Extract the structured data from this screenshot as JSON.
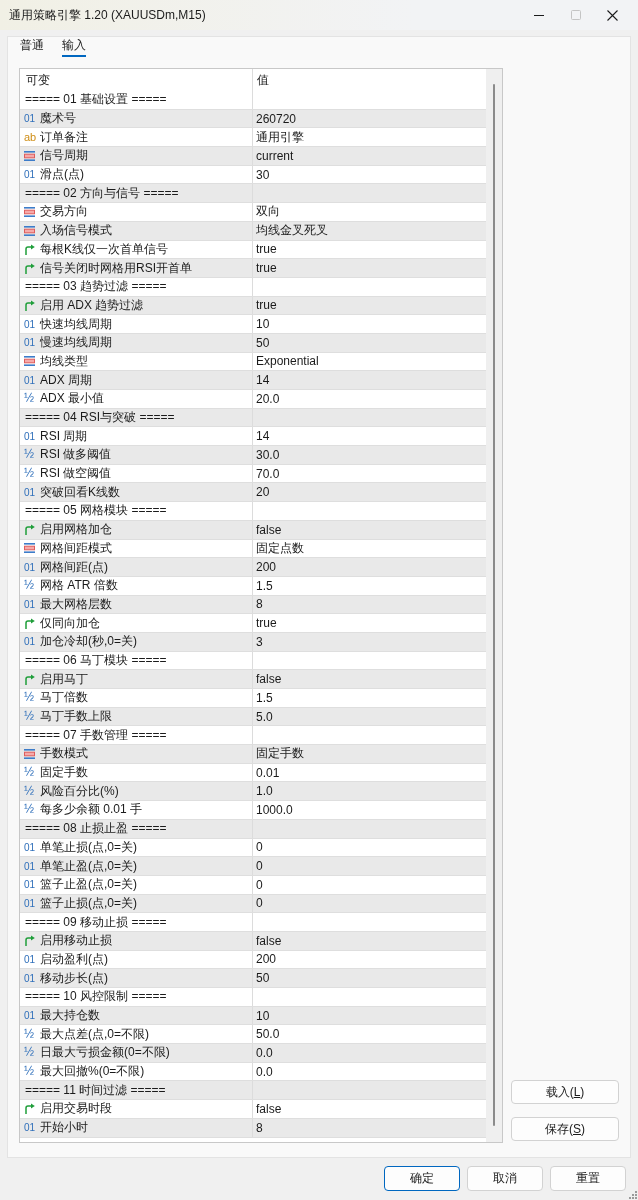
{
  "window": {
    "title": "通用策略引擎 1.20 (XAUUSDm,M15)",
    "controls": [
      {
        "kind": "minimize",
        "disabled": false
      },
      {
        "kind": "maximize",
        "disabled": true
      },
      {
        "kind": "close",
        "disabled": false
      }
    ]
  },
  "tabs": [
    {
      "label": "普通",
      "selected": false
    },
    {
      "label": "输入",
      "selected": true
    }
  ],
  "table": {
    "columns": [
      "可变",
      "值"
    ],
    "rows": [
      {
        "kind": "section",
        "label": "===== 01 基础设置 ====="
      },
      {
        "kind": "int",
        "glyph": "01",
        "name": "魔术号",
        "value": "260720"
      },
      {
        "kind": "string",
        "glyph": "ab",
        "name": "订单备注",
        "value": "通用引擎"
      },
      {
        "kind": "enum",
        "name": "信号周期",
        "value": "current"
      },
      {
        "kind": "int",
        "glyph": "01",
        "name": "滑点(点)",
        "value": "30"
      },
      {
        "kind": "section",
        "label": "===== 02 方向与信号 ====="
      },
      {
        "kind": "enum",
        "name": "交易方向",
        "value": "双向"
      },
      {
        "kind": "enum",
        "name": "入场信号模式",
        "value": "均线金叉死叉"
      },
      {
        "kind": "bool",
        "name": "每根K线仅一次首单信号",
        "value": "true"
      },
      {
        "kind": "bool",
        "name": "信号关闭时网格用RSI开首单",
        "value": "true"
      },
      {
        "kind": "section",
        "label": "===== 03 趋势过滤 ====="
      },
      {
        "kind": "bool",
        "name": "启用 ADX 趋势过滤",
        "value": "true"
      },
      {
        "kind": "int",
        "glyph": "01",
        "name": "快速均线周期",
        "value": "10"
      },
      {
        "kind": "int",
        "glyph": "01",
        "name": "慢速均线周期",
        "value": "50"
      },
      {
        "kind": "enum",
        "name": "均线类型",
        "value": "Exponential"
      },
      {
        "kind": "int",
        "glyph": "01",
        "name": "ADX 周期",
        "value": "14"
      },
      {
        "kind": "double",
        "glyph": "½",
        "name": "ADX 最小值",
        "value": "20.0"
      },
      {
        "kind": "section",
        "label": "===== 04 RSI与突破 ====="
      },
      {
        "kind": "int",
        "glyph": "01",
        "name": "RSI 周期",
        "value": "14"
      },
      {
        "kind": "double",
        "glyph": "½",
        "name": "RSI 做多阈值",
        "value": "30.0"
      },
      {
        "kind": "double",
        "glyph": "½",
        "name": "RSI 做空阈值",
        "value": "70.0"
      },
      {
        "kind": "int",
        "glyph": "01",
        "name": "突破回看K线数",
        "value": "20"
      },
      {
        "kind": "section",
        "label": "===== 05 网格模块 ====="
      },
      {
        "kind": "bool",
        "name": "启用网格加仓",
        "value": "false"
      },
      {
        "kind": "enum",
        "name": "网格间距模式",
        "value": "固定点数"
      },
      {
        "kind": "int",
        "glyph": "01",
        "name": "网格间距(点)",
        "value": "200"
      },
      {
        "kind": "double",
        "glyph": "½",
        "name": "网格 ATR 倍数",
        "value": "1.5"
      },
      {
        "kind": "int",
        "glyph": "01",
        "name": "最大网格层数",
        "value": "8"
      },
      {
        "kind": "bool",
        "name": "仅同向加仓",
        "value": "true"
      },
      {
        "kind": "int",
        "glyph": "01",
        "name": "加仓冷却(秒,0=关)",
        "value": "3"
      },
      {
        "kind": "section",
        "label": "===== 06 马丁模块 ====="
      },
      {
        "kind": "bool",
        "name": "启用马丁",
        "value": "false"
      },
      {
        "kind": "double",
        "glyph": "½",
        "name": "马丁倍数",
        "value": "1.5"
      },
      {
        "kind": "double",
        "glyph": "½",
        "name": "马丁手数上限",
        "value": "5.0"
      },
      {
        "kind": "section",
        "label": "===== 07 手数管理 ====="
      },
      {
        "kind": "enum",
        "name": "手数模式",
        "value": "固定手数"
      },
      {
        "kind": "double",
        "glyph": "½",
        "name": "固定手数",
        "value": "0.01"
      },
      {
        "kind": "double",
        "glyph": "½",
        "name": "风险百分比(%)",
        "value": "1.0"
      },
      {
        "kind": "double",
        "glyph": "½",
        "name": "每多少余额 0.01 手",
        "value": "1000.0"
      },
      {
        "kind": "section",
        "label": "===== 08 止损止盈 ====="
      },
      {
        "kind": "int",
        "glyph": "01",
        "name": "单笔止损(点,0=关)",
        "value": "0"
      },
      {
        "kind": "int",
        "glyph": "01",
        "name": "单笔止盈(点,0=关)",
        "value": "0"
      },
      {
        "kind": "int",
        "glyph": "01",
        "name": "篮子止盈(点,0=关)",
        "value": "0"
      },
      {
        "kind": "int",
        "glyph": "01",
        "name": "篮子止损(点,0=关)",
        "value": "0"
      },
      {
        "kind": "section",
        "label": "===== 09 移动止损 ====="
      },
      {
        "kind": "bool",
        "name": "启用移动止损",
        "value": "false"
      },
      {
        "kind": "int",
        "glyph": "01",
        "name": "启动盈利(点)",
        "value": "200"
      },
      {
        "kind": "int",
        "glyph": "01",
        "name": "移动步长(点)",
        "value": "50"
      },
      {
        "kind": "section",
        "label": "===== 10 风控限制 ====="
      },
      {
        "kind": "int",
        "glyph": "01",
        "name": "最大持仓数",
        "value": "10"
      },
      {
        "kind": "double",
        "glyph": "½",
        "name": "最大点差(点,0=不限)",
        "value": "50.0"
      },
      {
        "kind": "double",
        "glyph": "½",
        "name": "日最大亏损金额(0=不限)",
        "value": "0.0"
      },
      {
        "kind": "double",
        "glyph": "½",
        "name": "最大回撤%(0=不限)",
        "value": "0.0"
      },
      {
        "kind": "section",
        "label": "===== 11 时间过滤 ====="
      },
      {
        "kind": "bool",
        "name": "启用交易时段",
        "value": "false"
      },
      {
        "kind": "int",
        "glyph": "01",
        "name": "开始小时",
        "value": "8"
      }
    ]
  },
  "side_buttons": [
    {
      "text_before": "载入(",
      "access_key": "L",
      "text_after": ")"
    },
    {
      "text_before": "保存(",
      "access_key": "S",
      "text_after": ")"
    }
  ],
  "footer_buttons": [
    {
      "label": "确定",
      "default": true
    },
    {
      "label": "取消",
      "default": false
    },
    {
      "label": "重置",
      "default": false
    }
  ]
}
